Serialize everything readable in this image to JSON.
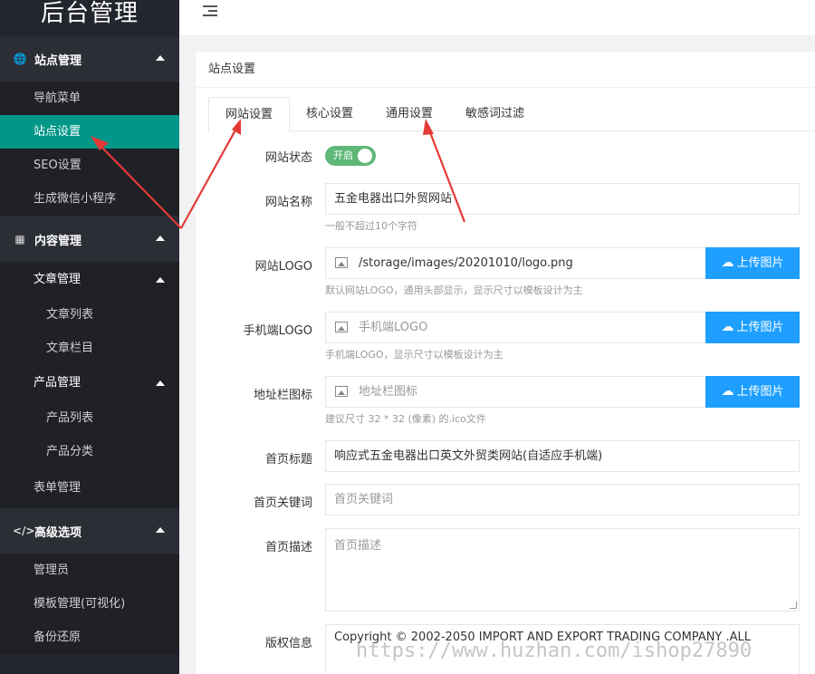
{
  "colors": {
    "sidebar_bg": "#23262e",
    "active": "#009688",
    "upload": "#1e9fff",
    "switch_on": "#5fb878"
  },
  "sidebar": {
    "logo": "后台管理",
    "groups": [
      {
        "title": "站点管理",
        "icon": "globe-icon",
        "items": [
          "导航菜单",
          "站点设置",
          "SEO设置",
          "生成微信小程序"
        ],
        "active": "站点设置"
      },
      {
        "title": "内容管理",
        "icon": "calendar-icon",
        "sub": [
          {
            "title": "文章管理",
            "items": [
              "文章列表",
              "文章栏目"
            ]
          },
          {
            "title": "产品管理",
            "items": [
              "产品列表",
              "产品分类"
            ]
          }
        ],
        "extra": "表单管理"
      },
      {
        "title": "高级选项",
        "icon": "code-icon",
        "items": [
          "管理员",
          "模板管理(可视化)",
          "备份还原"
        ]
      }
    ]
  },
  "topbar": {
    "menu_icon": "menu-toggle-icon"
  },
  "card": {
    "title": "站点设置",
    "tabs": [
      "网站设置",
      "核心设置",
      "通用设置",
      "敏感词过滤"
    ],
    "active_tab": "网站设置"
  },
  "form": {
    "status": {
      "label": "网站状态",
      "switch_text": "开启",
      "on": true
    },
    "site_name": {
      "label": "网站名称",
      "value": "五金电器出口外贸网站",
      "hint": "一般不超过10个字符"
    },
    "site_logo": {
      "label": "网站LOGO",
      "value": "/storage/images/20201010/logo.png",
      "button": "上传图片",
      "hint": "默认网站LOGO，通用头部显示，显示尺寸以模板设计为主"
    },
    "mobile_logo": {
      "label": "手机端LOGO",
      "placeholder": "手机端LOGO",
      "button": "上传图片",
      "hint": "手机端LOGO，显示尺寸以模板设计为主"
    },
    "favicon": {
      "label": "地址栏图标",
      "placeholder": "地址栏图标",
      "button": "上传图片",
      "hint": "建议尺寸 32 * 32 (像素) 的.ico文件"
    },
    "home_title": {
      "label": "首页标题",
      "value": "响应式五金电器出口英文外贸类网站(自适应手机端)"
    },
    "home_keywords": {
      "label": "首页关键词",
      "placeholder": "首页关键词"
    },
    "home_desc": {
      "label": "首页描述",
      "placeholder": "首页描述"
    },
    "copyright": {
      "label": "版权信息",
      "value": "Copyright © 2002-2050 IMPORT AND EXPORT TRADING COMPANY .ALL"
    }
  },
  "watermark": "https://www.huzhan.com/ishop27890"
}
